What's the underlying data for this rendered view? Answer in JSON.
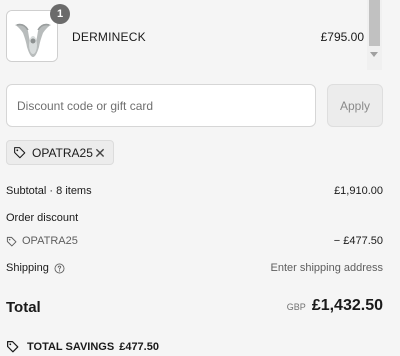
{
  "cart_item": {
    "name": "DERMINECK",
    "price": "£795.00",
    "quantity": "1"
  },
  "discount": {
    "placeholder": "Discount code or gift card",
    "apply_label": "Apply",
    "applied_code": "OPATRA25"
  },
  "summary": {
    "subtotal_label": "Subtotal · 8 items",
    "subtotal_value": "£1,910.00",
    "order_discount_label": "Order discount",
    "discount_code": "OPATRA25",
    "discount_value": "− £477.50",
    "shipping_label": "Shipping",
    "shipping_value": "Enter shipping address",
    "total_label": "Total",
    "currency": "GBP",
    "total_value": "£1,432.50",
    "savings_label": "TOTAL SAVINGS",
    "savings_value": "£477.50"
  }
}
